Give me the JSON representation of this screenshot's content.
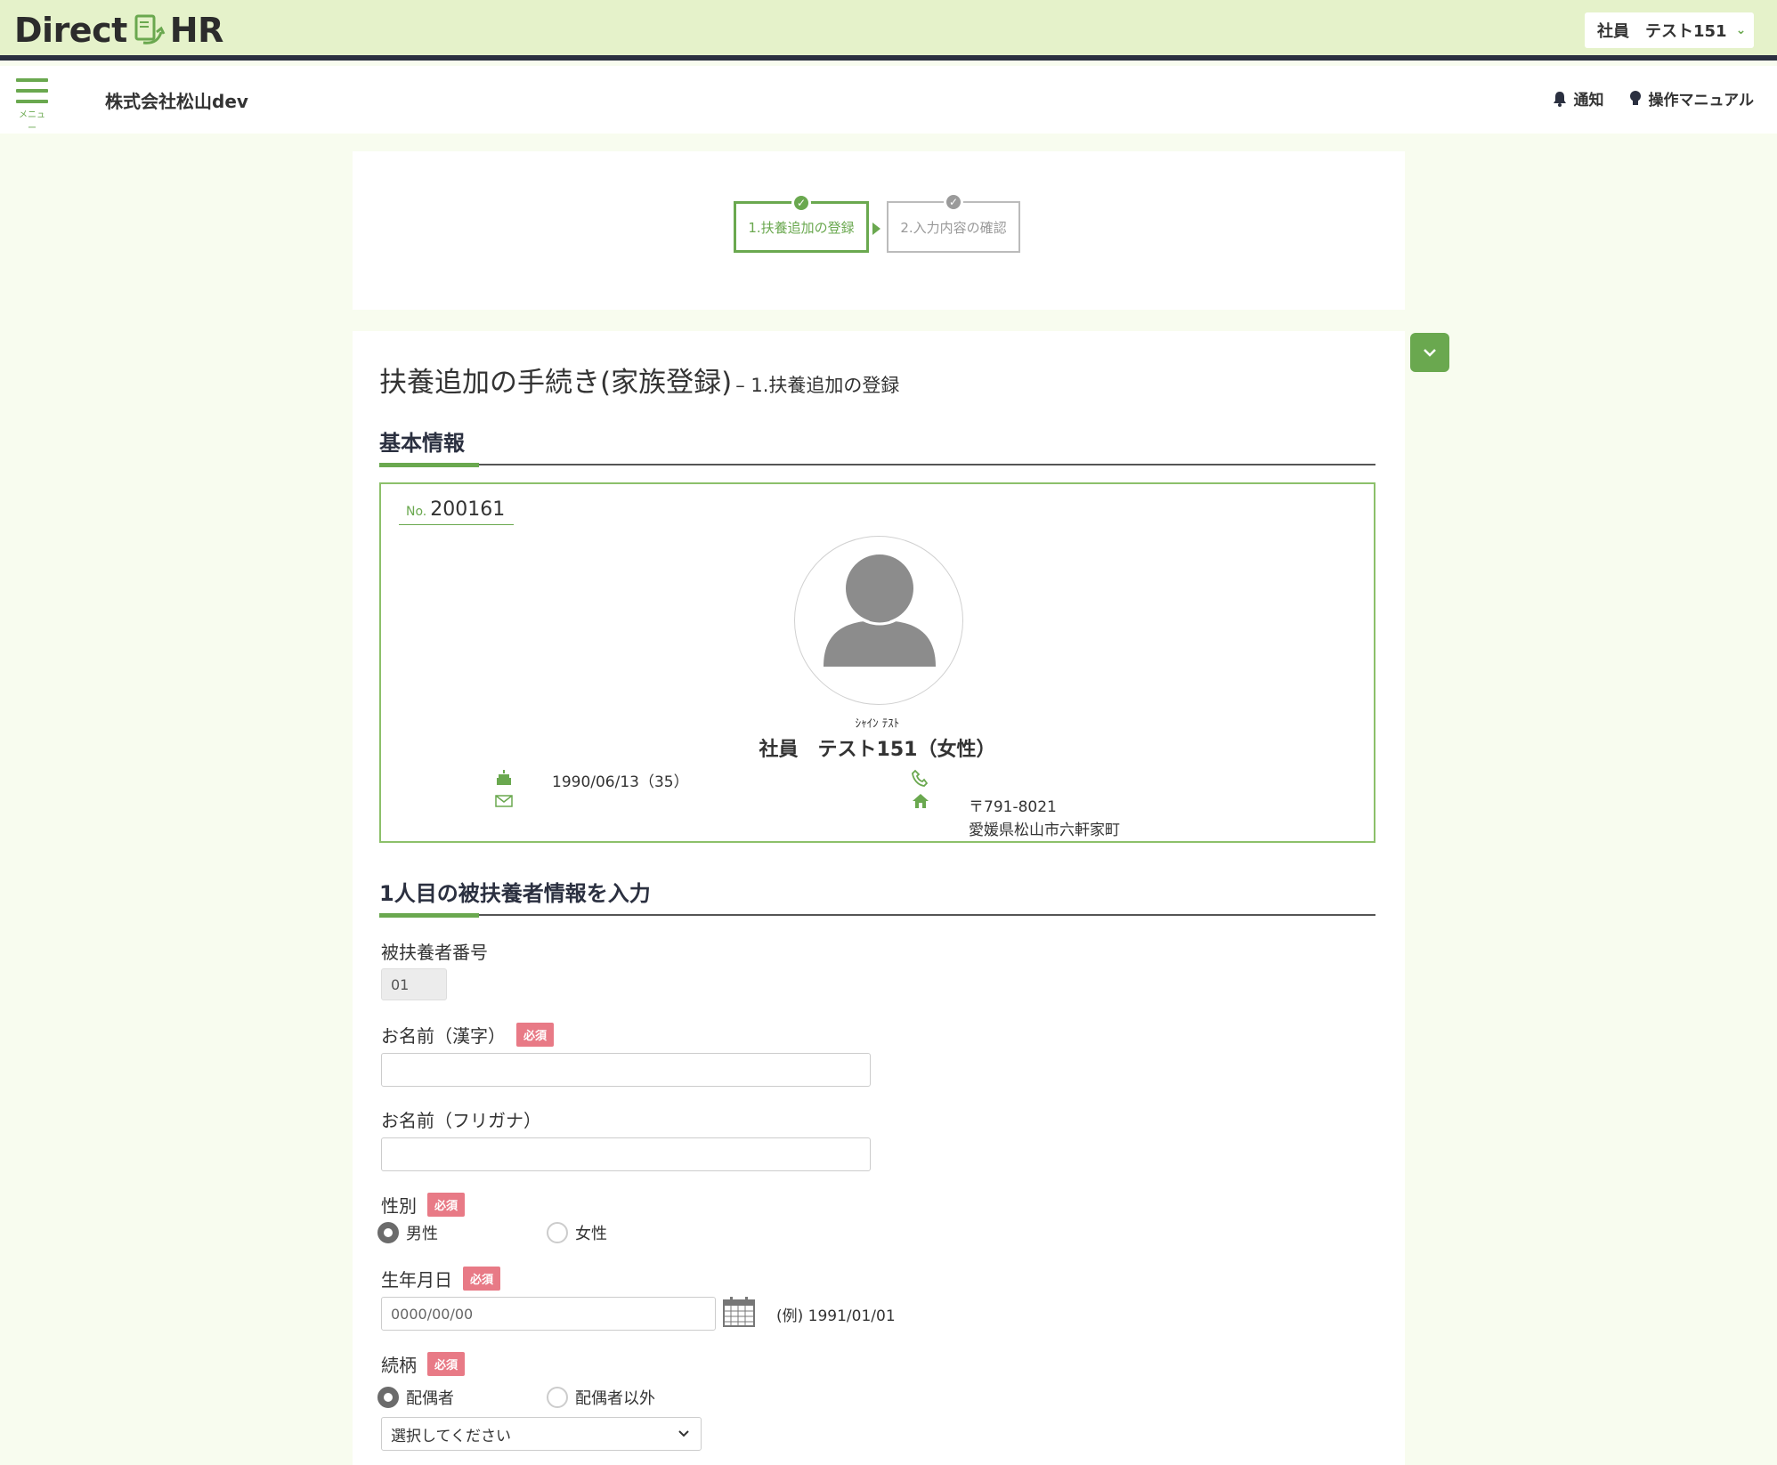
{
  "header": {
    "logo_left": "Direct",
    "logo_right": "HR",
    "user_menu": "社員　テスト151"
  },
  "subbar": {
    "menu_label": "メニュー",
    "company": "株式会社松山dev",
    "notify": "通知",
    "manual": "操作マニュアル"
  },
  "steps": [
    {
      "label": "1.扶養追加の登録",
      "state": "active"
    },
    {
      "label": "2.入力内容の確認",
      "state": "inactive"
    }
  ],
  "page": {
    "title": "扶養追加の手続き(家族登録)",
    "subtitle": "– 1.扶養追加の登録"
  },
  "basic_info": {
    "heading": "基本情報",
    "no_label": "No.",
    "no_value": "200161",
    "kana": "ｼｬｲﾝ ﾃｽﾄ",
    "name": "社員　テスト151（女性）",
    "birthday": "1990/06/13（35）",
    "postal": "〒791-8021",
    "address": "愛媛県松山市六軒家町"
  },
  "dependent": {
    "heading": "1人目の被扶養者情報を入力",
    "number_label": "被扶養者番号",
    "number_value": "01",
    "name_kanji_label": "お名前（漢字）",
    "name_kana_label": "お名前（フリガナ）",
    "gender_label": "性別",
    "gender_options": [
      "男性",
      "女性"
    ],
    "birthdate_label": "生年月日",
    "birthdate_placeholder": "0000/00/00",
    "birthdate_example": "(例) 1991/01/01",
    "relation_label": "続柄",
    "relation_options": [
      "配偶者",
      "配偶者以外"
    ],
    "relation_select": "選択してください",
    "required": "必須"
  },
  "colors": {
    "accent": "#6aa84f",
    "header_bg": "#e5f2ca",
    "required": "#e87a86"
  }
}
